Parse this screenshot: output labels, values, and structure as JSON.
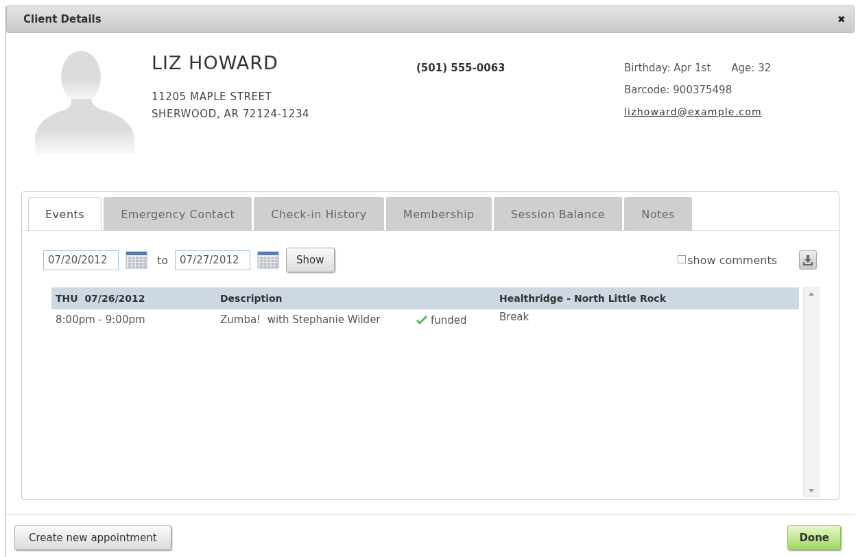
{
  "window": {
    "title": "Client Details",
    "close": "✖"
  },
  "client": {
    "name": "LIZ HOWARD",
    "address_lines": [
      "11205 MAPLE STREET",
      "SHERWOOD, AR 72124-1234"
    ],
    "phone": "(501) 555-0063",
    "birthday": "Birthday: Apr 1st",
    "age": "Age: 32",
    "barcode": "Barcode: 900375498",
    "email": "lizhoward@example.com"
  },
  "tabs": [
    {
      "label": "Events",
      "selected": true
    },
    {
      "label": "Emergency Contact",
      "selected": false
    },
    {
      "label": "Check-in History",
      "selected": false
    },
    {
      "label": "Membership",
      "selected": false
    },
    {
      "label": "Session Balance",
      "selected": false
    },
    {
      "label": "Notes",
      "selected": false
    }
  ],
  "filters": {
    "from": "07/20/2012",
    "separator": "to",
    "to": "07/27/2012",
    "show_button": "Show",
    "show_comments": {
      "label": "show comments",
      "checked": false
    }
  },
  "events": {
    "header": {
      "date": "THU  07/26/2012",
      "description": "Description",
      "location": "Healthridge - North Little Rock"
    },
    "rows": [
      {
        "time": "8:00pm - 9:00pm",
        "description": "Zumba!  with Stephanie Wilder",
        "funded": true,
        "status": "funded",
        "note": "Break"
      }
    ]
  },
  "footer": {
    "create_button": "Create new appointment",
    "done_button": "Done"
  }
}
